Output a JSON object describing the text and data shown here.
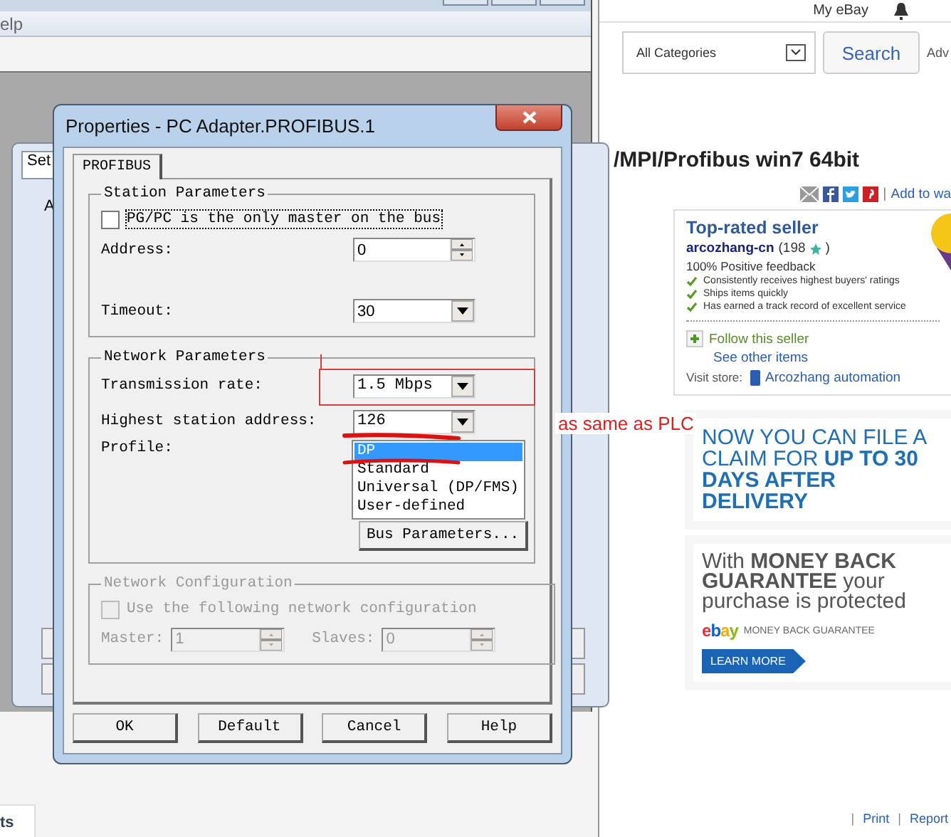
{
  "back_window": {
    "menu_fragment": "elp",
    "tab_fragment": "ts"
  },
  "settings_window": {
    "tab_fragment": "Set",
    "label_fragment": "A"
  },
  "dialog": {
    "title": "Properties - PC Adapter.PROFIBUS.1",
    "tabs": [
      {
        "label": "PROFIBUS",
        "selected": true
      }
    ],
    "station_parameters": {
      "title": "Station Parameters",
      "only_master": {
        "label": "PG/PC is the only master on the bus",
        "checked": false
      },
      "address": {
        "label": "Address:",
        "value": "0"
      },
      "timeout": {
        "label": "Timeout:",
        "value": "30"
      }
    },
    "network_parameters": {
      "title": "Network Parameters",
      "transmission_rate": {
        "label": "Transmission rate:",
        "value": "1.5 Mbps"
      },
      "highest_station_address": {
        "label": "Highest station address:",
        "value": "126"
      },
      "profile": {
        "label": "Profile:",
        "options": [
          {
            "label": "DP",
            "selected": true
          },
          {
            "label": "Standard",
            "selected": false
          },
          {
            "label": "Universal (DP/FMS)",
            "selected": false
          },
          {
            "label": "User-defined",
            "selected": false
          }
        ]
      },
      "bus_parameters_button": "Bus Parameters..."
    },
    "network_configuration": {
      "title": "Network Configuration",
      "disabled": true,
      "use_configuration": {
        "label": "Use the following network configuration",
        "checked": false
      },
      "master": {
        "label": "Master:",
        "value": "1"
      },
      "slaves": {
        "label": "Slaves:",
        "value": "0"
      }
    },
    "buttons": [
      "OK",
      "Default",
      "Cancel",
      "Help"
    ]
  },
  "annotation": {
    "note": "as same as PLC"
  },
  "ebay": {
    "header_link": "My eBay",
    "category": "All Categories",
    "search_button": "Search",
    "advanced_fragment": "Adv",
    "title": "/MPI/Profibus win7 64bit",
    "share_separator": "|",
    "watch_link": "Add to wa",
    "seller": {
      "heading": "Top-rated seller",
      "name": "arcozhang-cn",
      "score": "(198",
      "score_close": ")",
      "positive": "100% Positive feedback",
      "features": [
        "Consistently receives highest buyers' ratings",
        "Ships items quickly",
        "Has earned a track record of excellent service"
      ],
      "follow": "Follow this seller",
      "see_other": "See other items",
      "visit_label": "Visit store:",
      "store": "Arcozhang automation"
    },
    "claim_banner": "NOW YOU CAN FILE A CLAIM FOR **UP TO 30 DAYS AFTER DELIVERY**",
    "guarantee_banner": {
      "text": "With **MONEY BACK GUARANTEE** your purchase is protected",
      "logo": "ebay",
      "logo_caption": "MONEY BACK GUARANTEE",
      "button": "LEARN MORE"
    },
    "footer": [
      {
        "kind": "separator",
        "text": "|"
      },
      {
        "kind": "link",
        "text": "Print"
      },
      {
        "kind": "separator",
        "text": "|"
      },
      {
        "kind": "link",
        "text": "Report"
      }
    ]
  }
}
